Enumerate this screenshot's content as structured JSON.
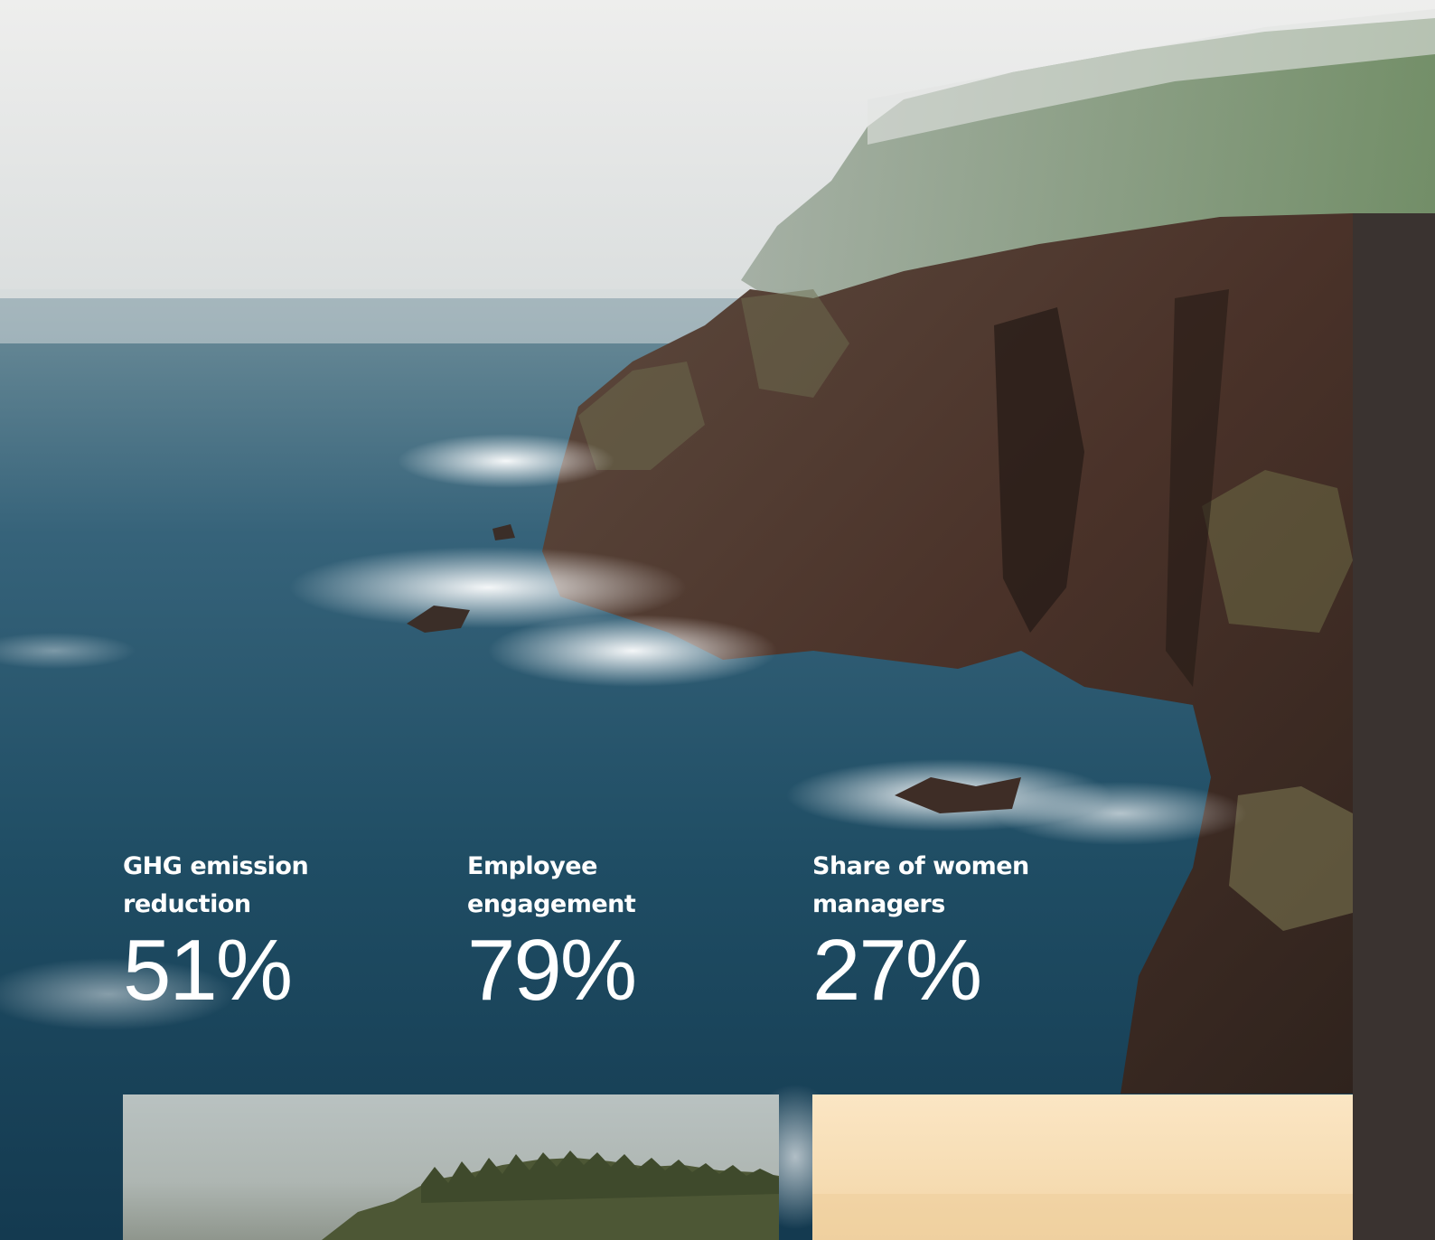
{
  "stats": [
    {
      "label": "GHG emission reduction",
      "value": "51%"
    },
    {
      "label": "Employee engagement",
      "value": "79%"
    },
    {
      "label": "Share of women managers",
      "value": "27%"
    }
  ],
  "colors": {
    "panel": "#3a3330",
    "text": "#ffffff",
    "sea": "#1d4a60",
    "fog": "#e4e5e4"
  },
  "images": {
    "hero": "coastal-cliff-photo",
    "card_left": "forest-island-photo",
    "card_right": "sunset-photo"
  }
}
